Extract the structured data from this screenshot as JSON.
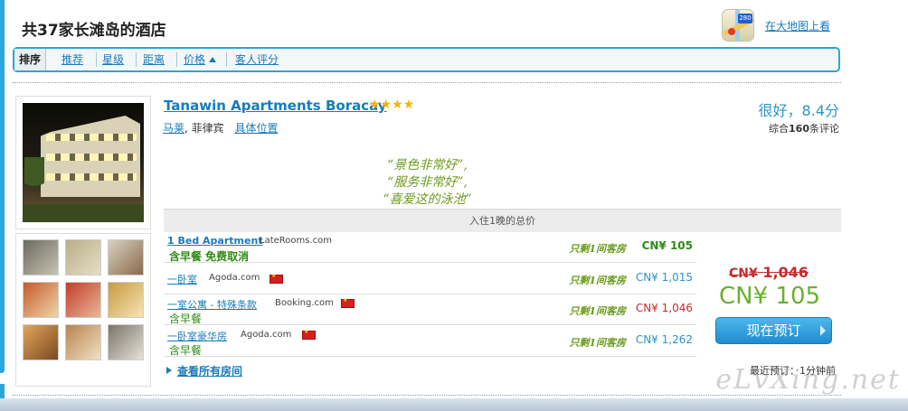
{
  "header": {
    "title": "共37家长滩岛的酒店",
    "map_link": "在大地图上看",
    "map_badge": "280"
  },
  "sort_bar": {
    "label": "排序",
    "options": [
      "推荐",
      "星级",
      "距离",
      "价格",
      "客人评分"
    ]
  },
  "hotel": {
    "name": "Tanawin Apartments Boracay",
    "stars": "★★★★",
    "location_area": "马莱",
    "location_country": ", 菲律宾",
    "location_link": "具体位置",
    "rating_text": "很好，8.4分",
    "reviews_prefix": "综合",
    "reviews_count": "160",
    "reviews_suffix": "条评论",
    "quotes": [
      "“景色非常好”,",
      "“服务非常好”,",
      "“喜爱这的泳池”"
    ],
    "price_header": "入住1晚的总价"
  },
  "offers": [
    {
      "room": "1 Bed Apartment",
      "site": "LateRooms.com",
      "perks": "含早餐  免费取消",
      "note": "只剩1间客房",
      "price": "CN¥ 105",
      "price_color": "#2f8a16"
    },
    {
      "room": "一卧室",
      "site": "Agoda.com",
      "perks": "",
      "note": "只剩1间客房",
      "price": "CN¥ 1,015",
      "price_color": "#2a95c9"
    },
    {
      "room": "一室公寓 - 特殊条款",
      "site": "Booking.com",
      "perks": "含早餐",
      "note": "只剩1间客房",
      "price": "CN¥ 1,046",
      "price_color": "#c62b2b"
    },
    {
      "room": "一卧室豪华房",
      "site": "Agoda.com",
      "perks": "含早餐",
      "note": "只剩1间客房",
      "price": "CN¥ 1,262",
      "price_color": "#2a95c9"
    }
  ],
  "deal": {
    "orig_currency": "CN¥",
    "orig_amount": "1,046",
    "price": "CN¥ 105",
    "book_label": "现在预订",
    "recent": "最近预订：1分钟前"
  },
  "view_all": "查看所有房间",
  "watermark": "eLvXing.net",
  "colors": {
    "accent": "#29a6da",
    "link": "#1a7bb9",
    "green": "#6ab02e",
    "red": "#c62b2b"
  }
}
